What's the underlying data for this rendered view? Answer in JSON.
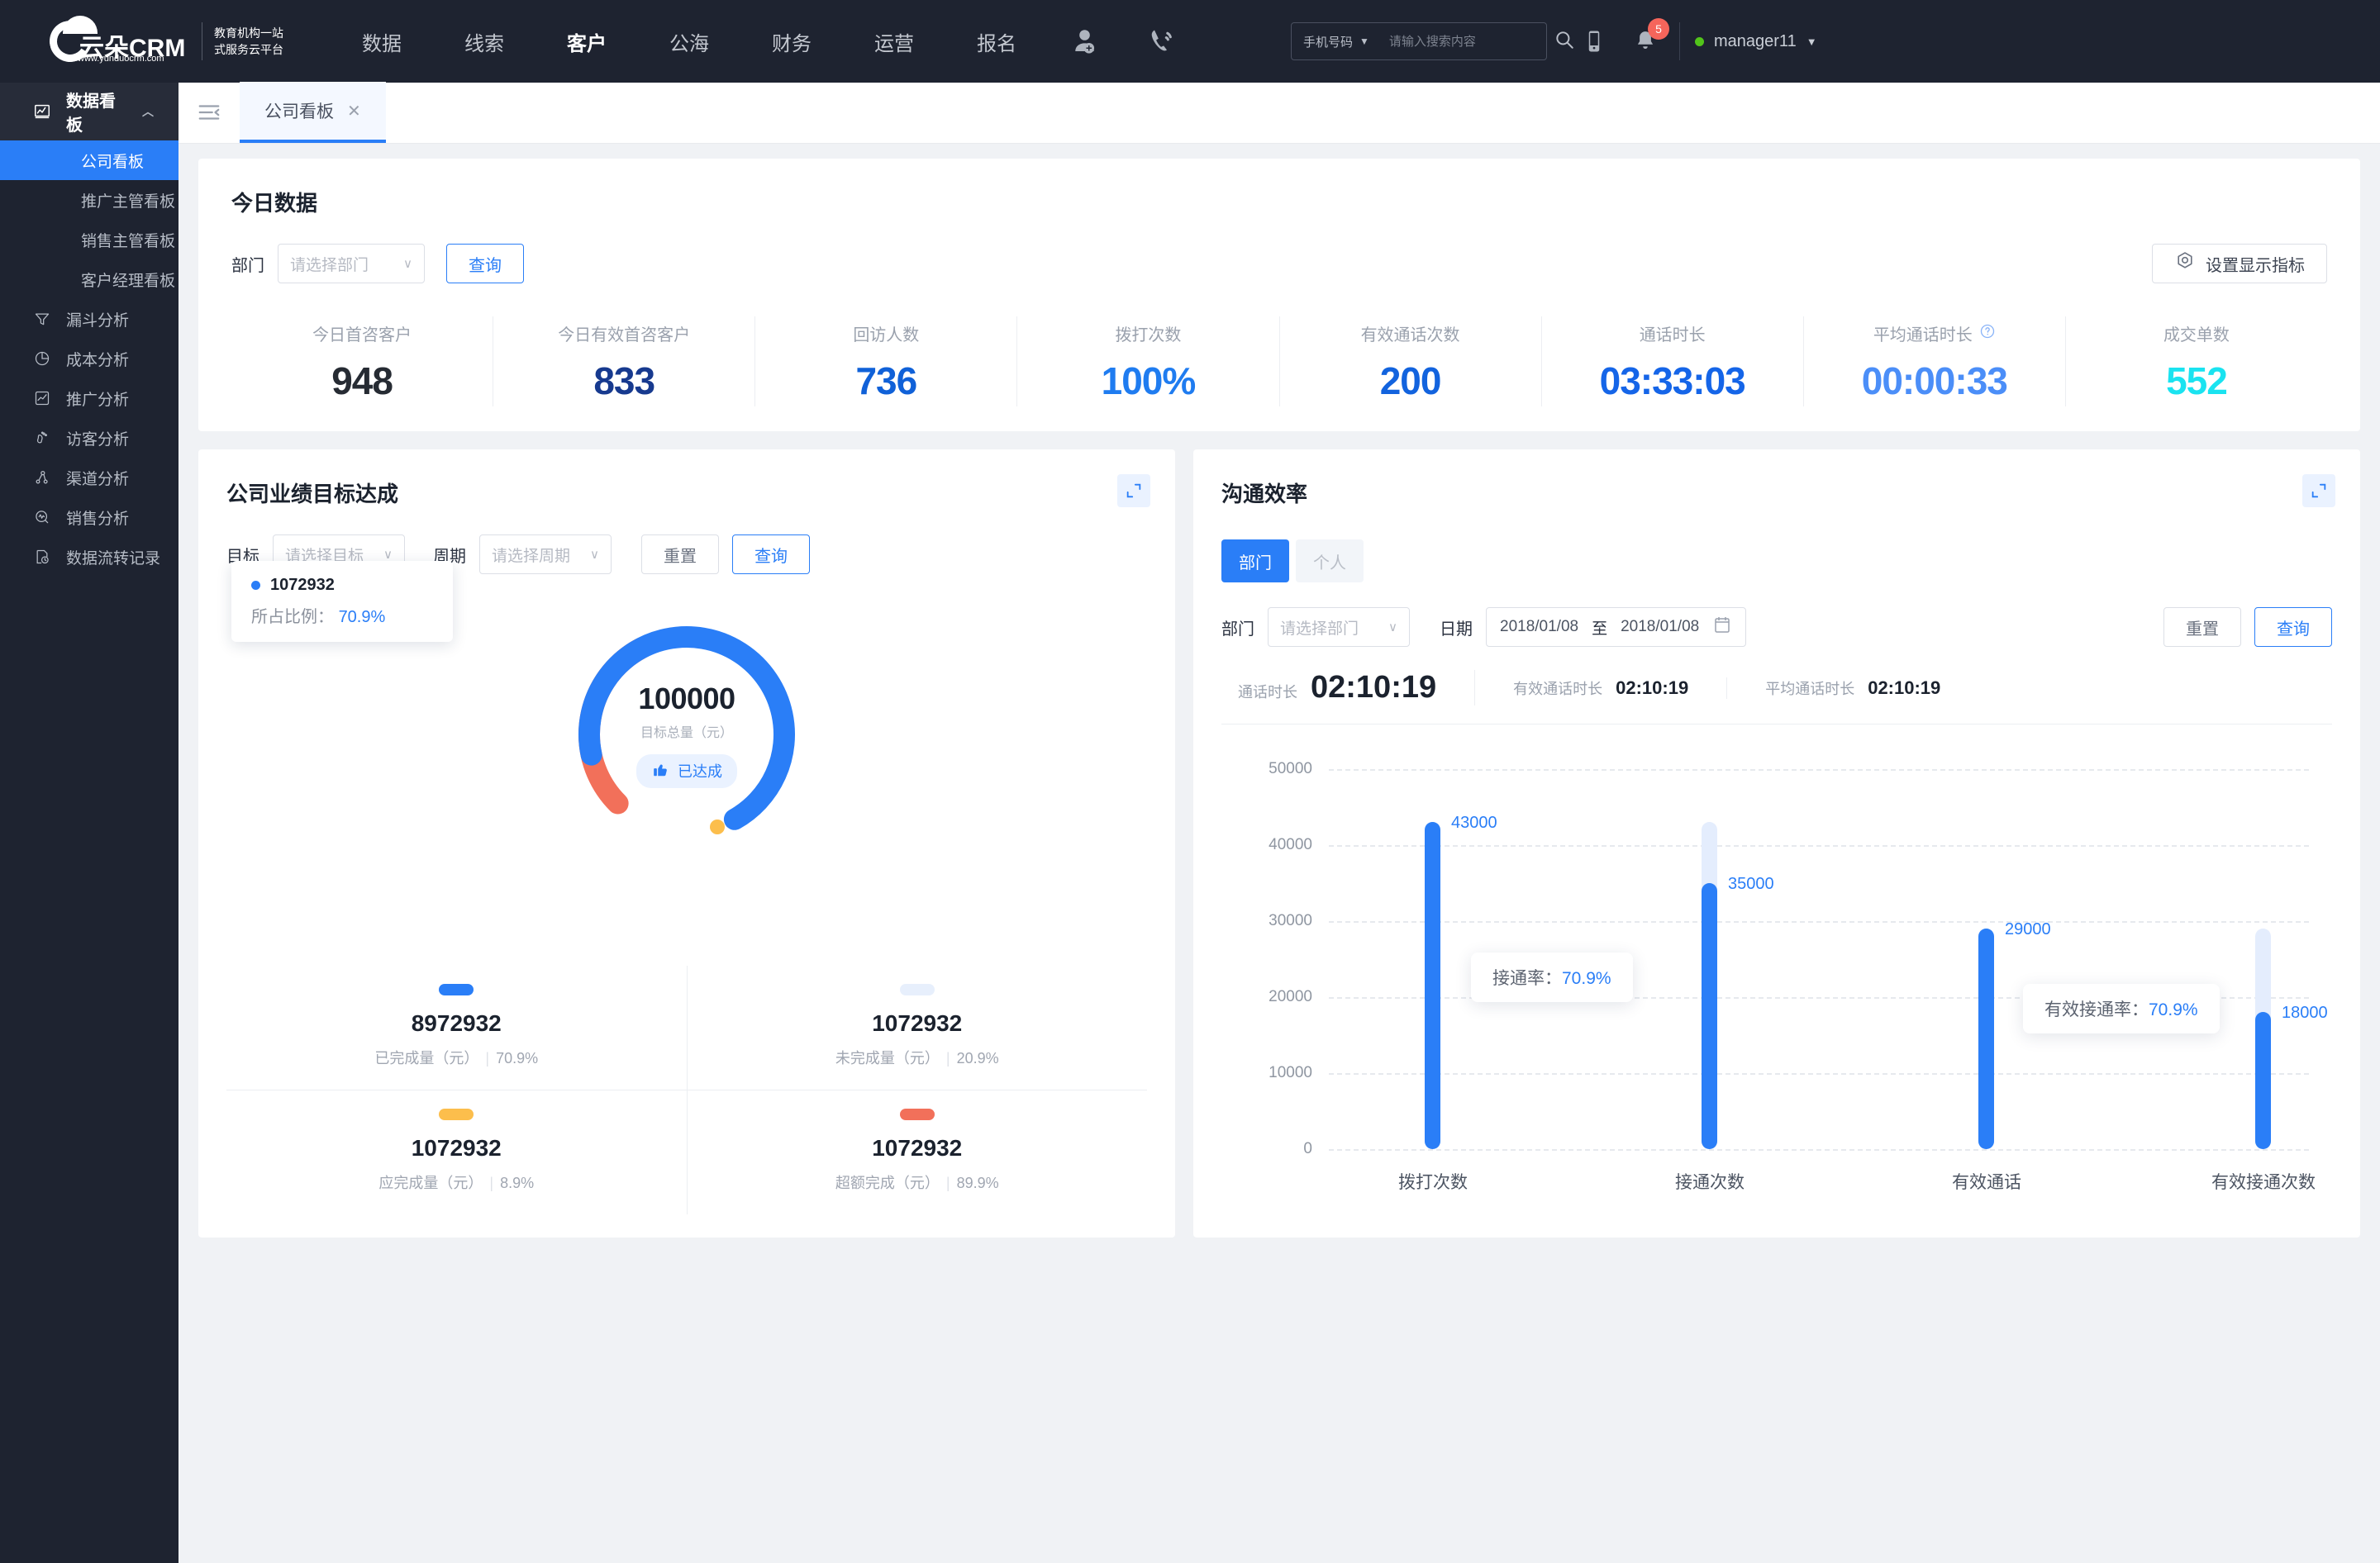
{
  "topnav": {
    "logo": {
      "brand": "云朵CRM",
      "url": "www.yunduocrm.com",
      "slogan_line1": "教育机构一站",
      "slogan_line2": "式服务云平台"
    },
    "menu": [
      {
        "label": "数据",
        "active": false
      },
      {
        "label": "线索",
        "active": false
      },
      {
        "label": "客户",
        "active": true
      },
      {
        "label": "公海",
        "active": false
      },
      {
        "label": "财务",
        "active": false
      },
      {
        "label": "运营",
        "active": false
      },
      {
        "label": "报名",
        "active": false
      }
    ],
    "add_user_icon": "add-user-icon",
    "call_icon": "phone-call-icon",
    "search": {
      "type_label": "手机号码",
      "placeholder": "请输入搜索内容",
      "value": "",
      "icon": "search-icon"
    },
    "mobile_icon": "mobile-phone-icon",
    "notification": {
      "icon": "bell-icon",
      "count": "5"
    },
    "user": {
      "name": "manager11",
      "status_color": "#52c41a"
    }
  },
  "sidebar": {
    "group": {
      "label": "数据看板",
      "icon": "dashboard-chart-icon",
      "chevron": "chevron-up-icon"
    },
    "sub_items": [
      {
        "label": "公司看板",
        "active": true
      },
      {
        "label": "推广主管看板",
        "active": false
      },
      {
        "label": "销售主管看板",
        "active": false
      },
      {
        "label": "客户经理看板",
        "active": false
      }
    ],
    "items": [
      {
        "label": "漏斗分析",
        "icon": "funnel-icon"
      },
      {
        "label": "成本分析",
        "icon": "pie-chart-icon"
      },
      {
        "label": "推广分析",
        "icon": "trend-box-icon"
      },
      {
        "label": "访客分析",
        "icon": "footprint-icon"
      },
      {
        "label": "渠道分析",
        "icon": "share-nodes-icon"
      },
      {
        "label": "销售分析",
        "icon": "pulse-search-icon"
      },
      {
        "label": "数据流转记录",
        "icon": "file-clock-icon"
      }
    ]
  },
  "tabbar": {
    "collapse_icon": "collapse-menu-icon",
    "tabs": [
      {
        "label": "公司看板",
        "close_icon": "close-icon",
        "active": true
      }
    ]
  },
  "today_card": {
    "title": "今日数据",
    "dept_label": "部门",
    "dept_placeholder": "请选择部门",
    "query_button": "查询",
    "settings_button": "设置显示指标",
    "settings_icon": "gear-hex-icon",
    "kpis": [
      {
        "label": "今日首咨客户",
        "value": "948",
        "color": "#262b33",
        "help": false
      },
      {
        "label": "今日有效首咨客户",
        "value": "833",
        "color": "#173a8f",
        "help": false
      },
      {
        "label": "回访人数",
        "value": "736",
        "color": "#1061d8",
        "help": false
      },
      {
        "label": "拨打次数",
        "value": "100%",
        "color": "#1f7cf0",
        "help": false
      },
      {
        "label": "有效通话次数",
        "value": "200",
        "color": "#1263de",
        "help": false
      },
      {
        "label": "通话时长",
        "value": "03:33:03",
        "color": "#1565e8",
        "help": false
      },
      {
        "label": "平均通话时长",
        "value": "00:00:33",
        "color": "#4b8ef8",
        "help": true
      },
      {
        "label": "成交单数",
        "value": "552",
        "color": "#1ae3f0",
        "help": false
      }
    ]
  },
  "goal_card": {
    "title": "公司业绩目标达成",
    "expand_icon": "expand-icon",
    "goal_label": "目标",
    "goal_placeholder": "请选择目标",
    "period_label": "周期",
    "period_placeholder": "请选择周期",
    "reset_button": "重置",
    "query_button": "查询",
    "tooltip": {
      "value": "1072932",
      "ratio_label": "所占比例：",
      "ratio_value": "70.9%"
    },
    "donut": {
      "total": "100000",
      "total_label": "目标总量（元）",
      "status": "已达成",
      "status_icon": "thumbs-up-icon"
    },
    "legend": [
      {
        "color": "#2a7ef7",
        "value": "8972932",
        "label": "已完成量（元）",
        "pct": "70.9%"
      },
      {
        "color": "#e7effc",
        "value": "1072932",
        "label": "未完成量（元）",
        "pct": "20.9%"
      },
      {
        "color": "#fcbe4c",
        "value": "1072932",
        "label": "应完成量（元）",
        "pct": "8.9%"
      },
      {
        "color": "#f2705a",
        "value": "1072932",
        "label": "超额完成（元）",
        "pct": "89.9%"
      }
    ]
  },
  "comm_card": {
    "title": "沟通效率",
    "expand_icon": "expand-icon",
    "segments": [
      {
        "label": "部门",
        "active": true
      },
      {
        "label": "个人",
        "active": false
      }
    ],
    "dept_label": "部门",
    "dept_placeholder": "请选择部门",
    "date_label": "日期",
    "date_start": "2018/01/08",
    "date_to": "至",
    "date_end": "2018/01/08",
    "calendar_icon": "calendar-icon",
    "reset_button": "重置",
    "query_button": "查询",
    "durations": [
      {
        "label": "通话时长",
        "value": "02:10:19",
        "size": "large"
      },
      {
        "label": "有效通话时长",
        "value": "02:10:19",
        "size": "small"
      },
      {
        "label": "平均通话时长",
        "value": "02:10:19",
        "size": "small"
      }
    ],
    "tips": [
      {
        "label": "接通率：",
        "value": "70.9%"
      },
      {
        "label": "有效接通率：",
        "value": "70.9%"
      }
    ]
  },
  "chart_data": {
    "type": "bar",
    "title": "沟通效率",
    "categories": [
      "拨打次数",
      "接通次数",
      "有效通话",
      "有效接通次数"
    ],
    "values": [
      43000,
      35000,
      29000,
      18000
    ],
    "track_values": [
      43000,
      43000,
      29000,
      29000
    ],
    "labels": [
      "43000",
      "35000",
      "29000",
      "18000"
    ],
    "yticks": [
      0,
      10000,
      20000,
      30000,
      40000,
      50000
    ],
    "ytick_labels": [
      "0",
      "10000",
      "20000",
      "30000",
      "40000",
      "50000"
    ],
    "ylim": [
      0,
      50000
    ],
    "xlabel": "",
    "ylabel": "",
    "grid": true,
    "legend": "none",
    "bar_color": "#2a7ef7",
    "track_color": "#e4edfd",
    "annotations": [
      {
        "text": "接通率：70.9%",
        "between": [
          "拨打次数",
          "接通次数"
        ]
      },
      {
        "text": "有效接通率：70.9%",
        "between": [
          "有效通话",
          "有效接通次数"
        ]
      }
    ]
  }
}
